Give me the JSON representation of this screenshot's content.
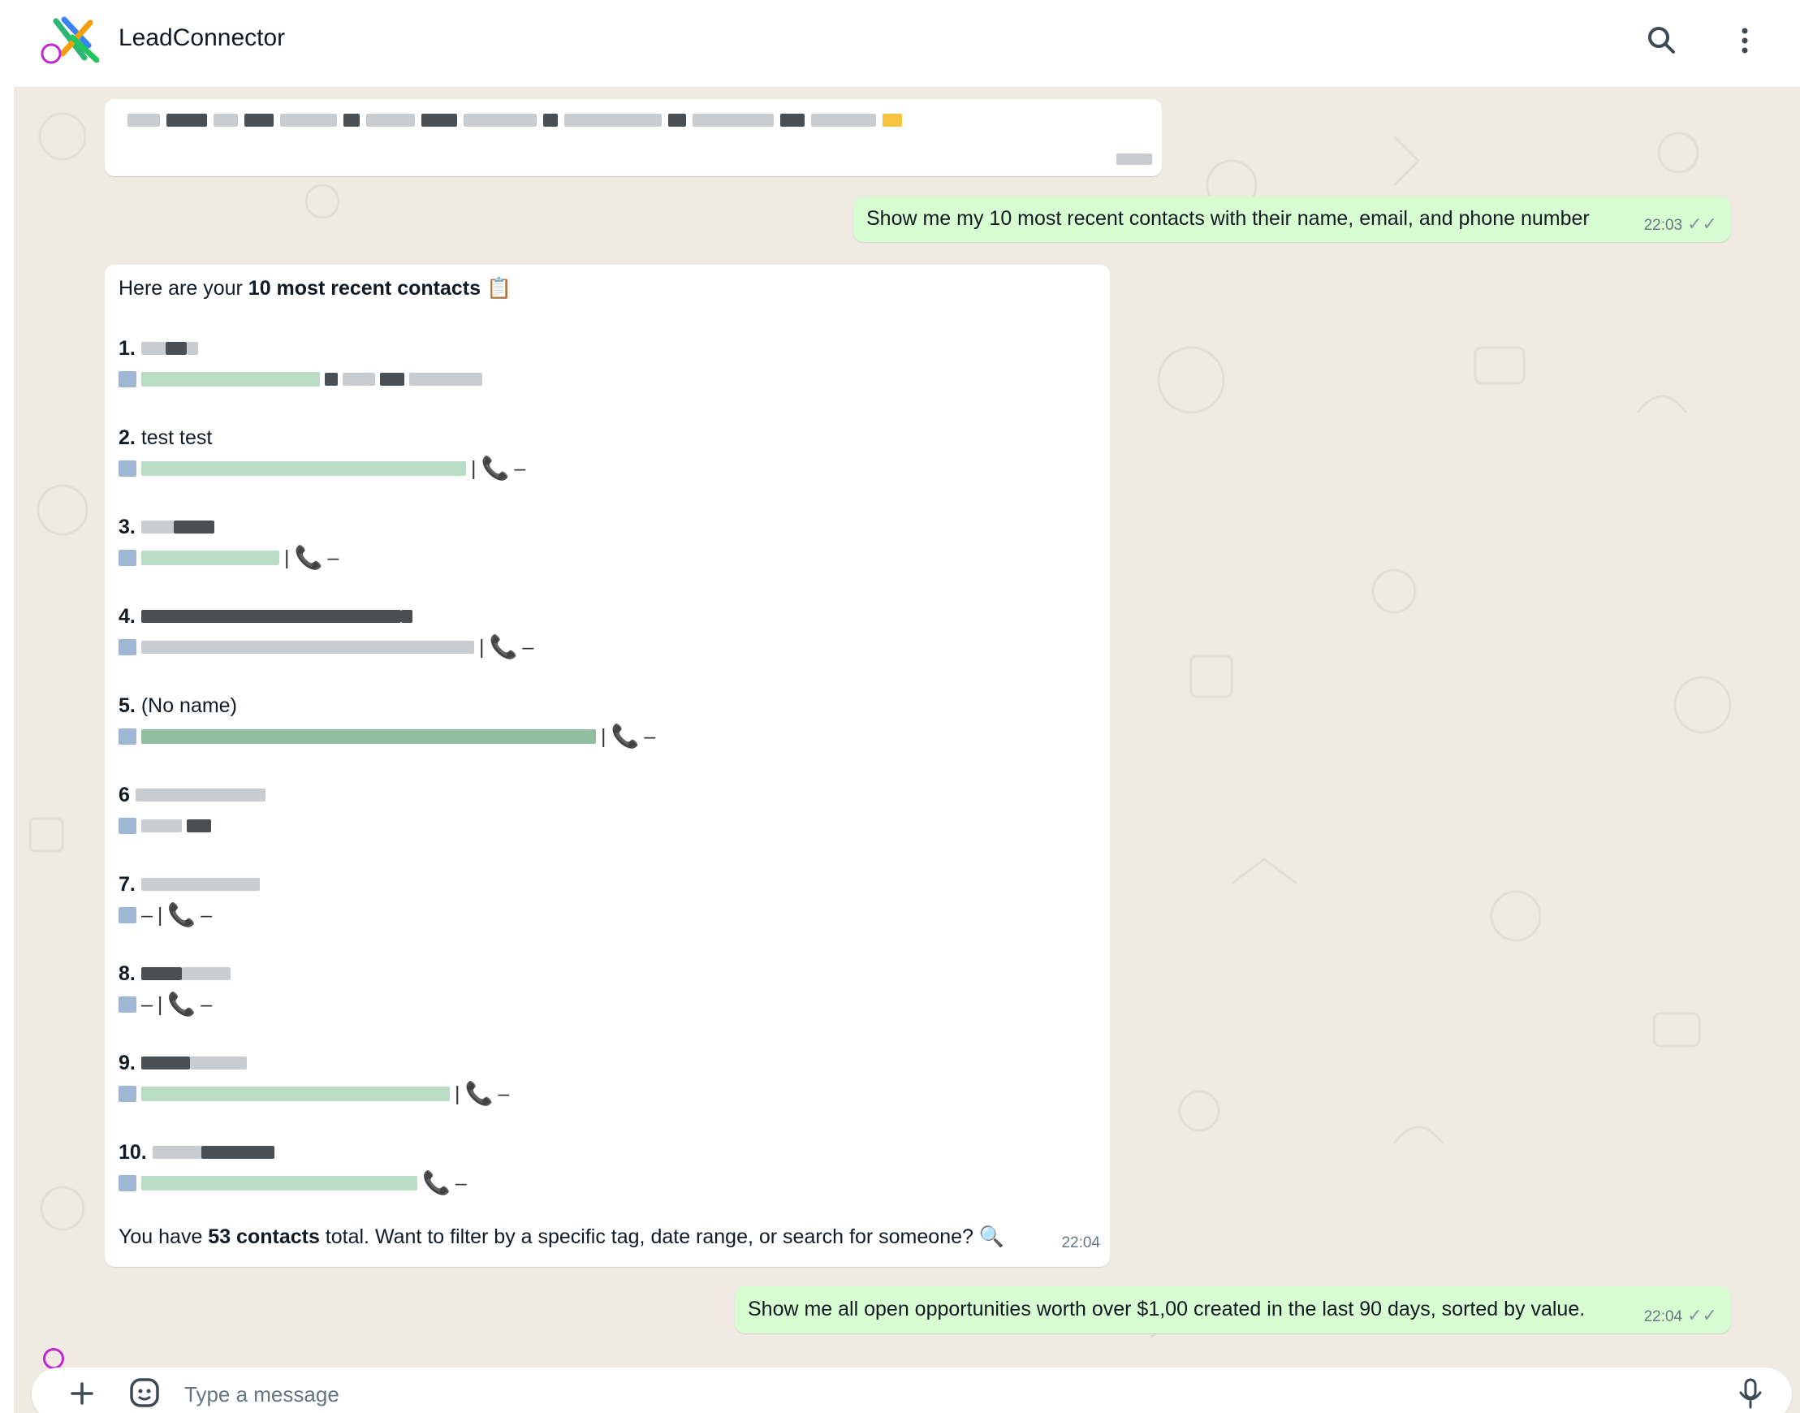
{
  "app": {
    "title": "LeadConnector"
  },
  "header": {
    "search_icon": "search-icon",
    "menu_icon": "more-vertical-icon"
  },
  "messages": {
    "m1": {
      "direction": "outgoing",
      "text": "Show me my 10 most recent contacts with their name, email, and phone number",
      "time": "22:03"
    },
    "m2": {
      "direction": "incoming",
      "intro_prefix": "Here are your ",
      "intro_bold": "10 most recent contacts",
      "intro_emoji": "📋",
      "contacts": [
        {
          "num": "1.",
          "name": "",
          "email": "",
          "phone": ""
        },
        {
          "num": "2.",
          "name": "test test",
          "email": "",
          "phone": "–"
        },
        {
          "num": "3.",
          "name": "",
          "email": "",
          "phone": "–"
        },
        {
          "num": "4.",
          "name": "",
          "email": "",
          "phone": "–"
        },
        {
          "num": "5.",
          "name": "(No name)",
          "email": "",
          "phone": "–"
        },
        {
          "num": "6",
          "name": "",
          "email": "",
          "phone": ""
        },
        {
          "num": "7.",
          "name": "",
          "email": "–",
          "phone": "–"
        },
        {
          "num": "8.",
          "name": "",
          "email": "–",
          "phone": "–"
        },
        {
          "num": "9.",
          "name": "",
          "email": "",
          "phone": "–"
        },
        {
          "num": "10.",
          "name": "",
          "email": "",
          "phone": "–"
        }
      ],
      "footer_prefix": "You have ",
      "footer_bold": "53 contacts",
      "footer_suffix": " total. Want to filter by a specific tag, date range, or search for someone?",
      "footer_emoji": "🔍",
      "time": "22:04"
    },
    "m3": {
      "direction": "outgoing",
      "text": "Show me all open opportunities worth over $1,00 created in the last 90 days, sorted by value.",
      "time": "22:04"
    }
  },
  "composer": {
    "placeholder": "Type a message"
  },
  "colors": {
    "outgoing_bubble": "#d9fdd3",
    "chat_bg": "#efeae2",
    "incoming_bubble": "#ffffff"
  }
}
